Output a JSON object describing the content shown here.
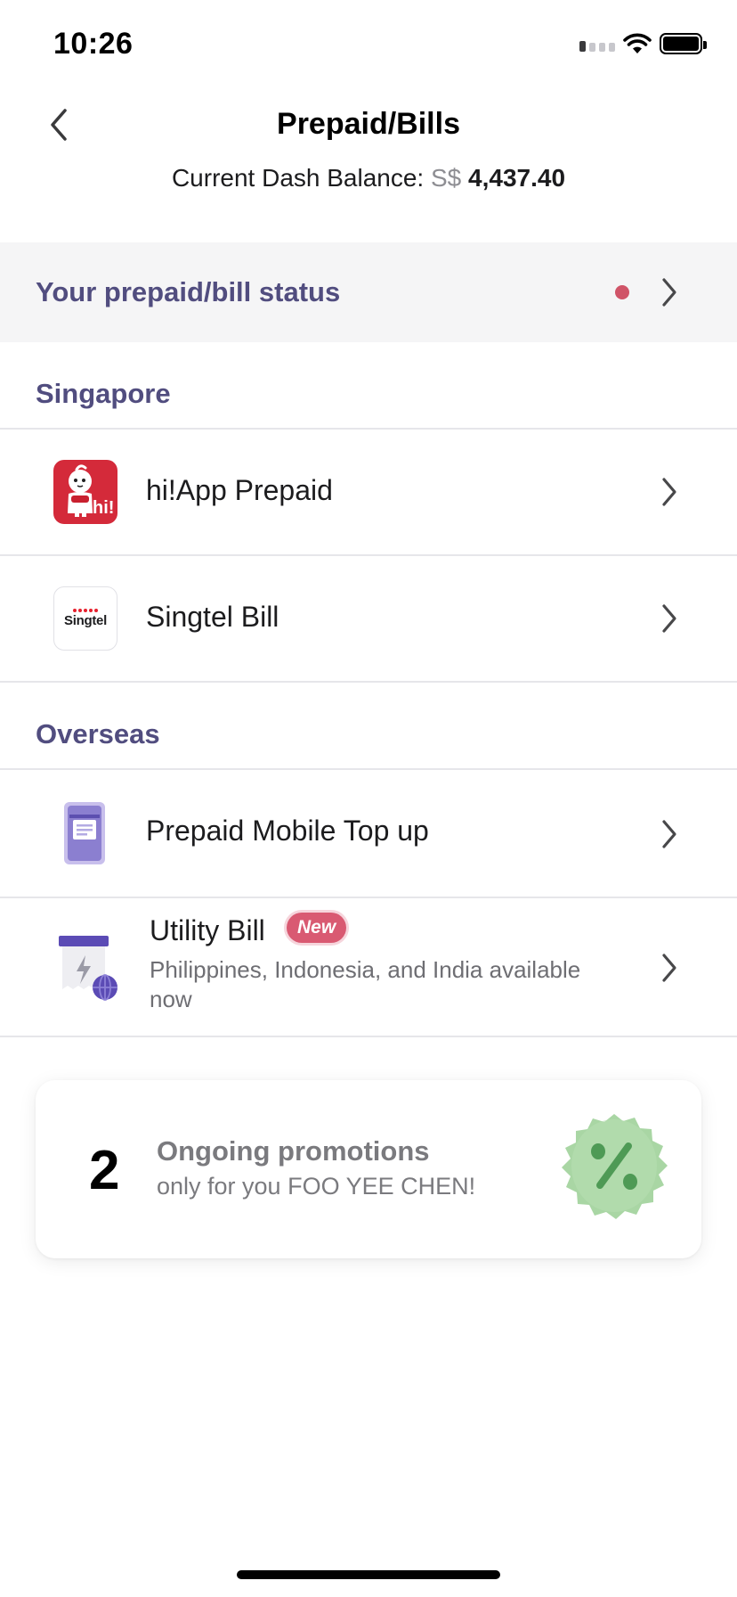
{
  "status_bar": {
    "time": "10:26"
  },
  "header": {
    "title": "Prepaid/Bills",
    "balance_label": "Current Dash Balance:",
    "balance_currency": "S$",
    "balance_amount": "4,437.40"
  },
  "status_row": {
    "label": "Your prepaid/bill status",
    "dot_color": "#d05468"
  },
  "sections": [
    {
      "title": "Singapore",
      "items": [
        {
          "label": "hi!App Prepaid",
          "icon": "hi-app-icon"
        },
        {
          "label": "Singtel Bill",
          "icon": "singtel-icon",
          "icon_text": "Singtel"
        }
      ]
    },
    {
      "title": "Overseas",
      "items": [
        {
          "label": "Prepaid Mobile Top up",
          "icon": "phone-receipt-icon"
        },
        {
          "label": "Utility Bill",
          "icon": "utility-bill-icon",
          "badge": "New",
          "subtitle": "Philippines, Indonesia, and India available now"
        }
      ]
    }
  ],
  "promo": {
    "count": "2",
    "title": "Ongoing promotions",
    "subtitle": "only for you FOO YEE CHEN!",
    "icon": "percent-badge-icon"
  },
  "colors": {
    "accent": "#514d7f",
    "badge": "#d95a72",
    "divider": "#e6e6ea",
    "hi_red": "#d42a3a",
    "promo_green": "#a9d6a4"
  }
}
